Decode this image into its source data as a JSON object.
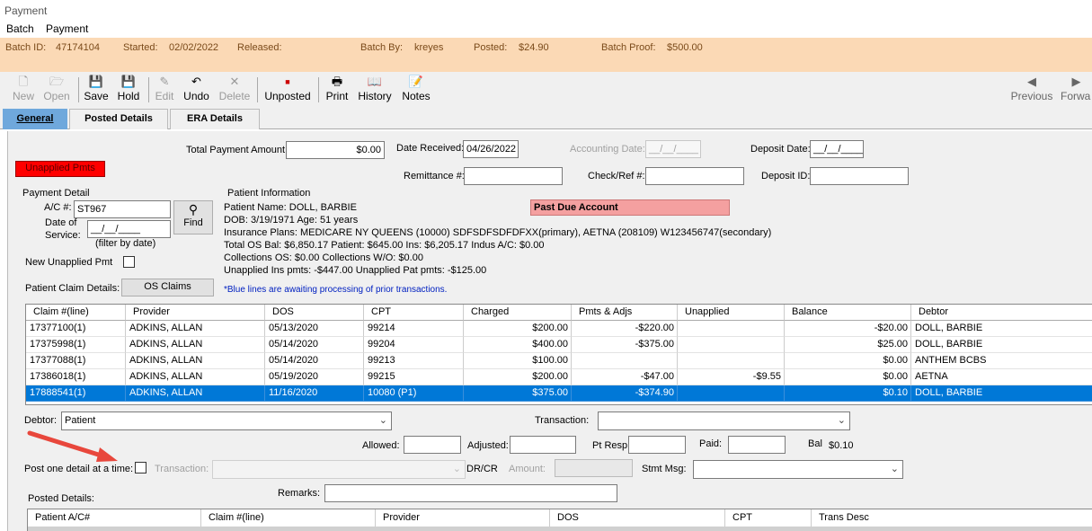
{
  "window": {
    "title": "Payment"
  },
  "menu": [
    "Batch",
    "Payment"
  ],
  "batch": {
    "batch_id_label": "Batch ID:",
    "batch_id": "47174104",
    "started_label": "Started:",
    "started": "02/02/2022",
    "released_label": "Released:",
    "released": "",
    "batch_by_label": "Batch By:",
    "batch_by": "kreyes",
    "posted_label": "Posted:",
    "posted": "$24.90",
    "batch_proof_label": "Batch Proof:",
    "batch_proof": "$500.00"
  },
  "toolbar": {
    "new": "New",
    "open": "Open",
    "save": "Save",
    "hold": "Hold",
    "edit": "Edit",
    "undo": "Undo",
    "delete": "Delete",
    "unposted": "Unposted",
    "print": "Print",
    "history": "History",
    "notes": "Notes",
    "previous": "Previous",
    "forward": "Forwa"
  },
  "tabs": [
    "General",
    "Posted Details",
    "ERA Details"
  ],
  "header": {
    "total_payment_label": "Total Payment Amount:",
    "total_payment": "$0.00",
    "date_received_label": "Date Received:",
    "date_received": "04/26/2022",
    "accounting_date_label": "Accounting Date:",
    "accounting_date": "__/__/____",
    "deposit_date_label": "Deposit Date:",
    "deposit_date": "__/__/____",
    "unapplied_pmts": "Unapplied Pmts",
    "remittance_label": "Remittance #:",
    "remittance": "",
    "check_ref_label": "Check/Ref #:",
    "check_ref": "",
    "deposit_id_label": "Deposit ID:",
    "deposit_id": ""
  },
  "payment_detail": {
    "title": "Payment Detail",
    "ac_label": "A/C #:",
    "ac": "ST967",
    "dos_label1": "Date of",
    "dos_label2": "Service:",
    "dos": "__/__/____",
    "find": "Find",
    "filter_note": "(filter by date)",
    "new_unapplied_label": "New Unapplied Pmt",
    "claim_details_label": "Patient Claim Details:",
    "os_claims": "OS Claims"
  },
  "patient_info": {
    "title": "Patient Information",
    "name_line": "Patient Name:  DOLL, BARBIE",
    "dob_line": "DOB: 3/19/1971     Age: 51 years",
    "plans_line": "Insurance Plans:  MEDICARE NY QUEENS (10000) SDFSDFSDFDFXX(primary), AETNA (208109) W123456747(secondary)",
    "bal_line": "Total OS Bal:  $6,850.17     Patient:  $645.00     Ins:  $6,205.17     Indus A/C:  $0.00",
    "collections_line": "Collections OS:  $0.00     Collections W/O:  $0.00",
    "unapplied_line": "Unapplied Ins pmts:  -$447.00     Unapplied Pat pmts: -$125.00",
    "past_due": "Past Due Account",
    "blue_note": "*Blue lines are awaiting processing of prior transactions."
  },
  "claims": {
    "columns": [
      "Claim #(line)",
      "Provider",
      "DOS",
      "CPT",
      "Charged",
      "Pmts & Adjs",
      "Unapplied",
      "Balance",
      "Debtor"
    ],
    "rows": [
      [
        "17377100(1)",
        "ADKINS, ALLAN",
        "05/13/2020",
        "99214",
        "$200.00",
        "-$220.00",
        "",
        "-$20.00",
        "DOLL, BARBIE"
      ],
      [
        "17375998(1)",
        "ADKINS, ALLAN",
        "05/14/2020",
        "99204",
        "$400.00",
        "-$375.00",
        "",
        "$25.00",
        "DOLL, BARBIE"
      ],
      [
        "17377088(1)",
        "ADKINS, ALLAN",
        "05/14/2020",
        "99213",
        "$100.00",
        "",
        "",
        "$0.00",
        "ANTHEM BCBS"
      ],
      [
        "17386018(1)",
        "ADKINS, ALLAN",
        "05/19/2020",
        "99215",
        "$200.00",
        "-$47.00",
        "-$9.55",
        "$0.00",
        "AETNA"
      ],
      [
        "17888541(1)",
        "ADKINS, ALLAN",
        "11/16/2020",
        "10080 (P1)",
        "$375.00",
        "-$374.90",
        "",
        "$0.10",
        "DOLL, BARBIE"
      ]
    ],
    "selected_row": 4
  },
  "posting": {
    "debtor_label": "Debtor:",
    "debtor": "Patient",
    "transaction_label": "Transaction:",
    "transaction": "",
    "allowed_label": "Allowed:",
    "allowed": "",
    "adjusted_label": "Adjusted:",
    "adjusted": "",
    "pt_resp_label": "Pt Resp:",
    "pt_resp": "",
    "paid_label": "Paid:",
    "paid": "",
    "bal_label": "Bal",
    "bal": "$0.10",
    "post_one_label": "Post one detail at a time:",
    "transaction2_label": "Transaction:",
    "drcr_label": "DR/CR",
    "amount_label": "Amount:",
    "stmt_msg_label": "Stmt Msg:",
    "remarks_label": "Remarks:",
    "remarks": "",
    "posted_details_label": "Posted Details:"
  },
  "posted_details": {
    "columns": [
      "Patient A/C#",
      "Claim #(line)",
      "Provider",
      "DOS",
      "CPT",
      "Trans Desc"
    ]
  },
  "colors": {
    "batch_bar": "#fbd9b5",
    "unapplied_btn": "#ff0000",
    "past_due": "#f4a0a0",
    "selected_row": "#0078d7",
    "active_tab": "#6fa8dc",
    "arrow": "#e8473c"
  }
}
